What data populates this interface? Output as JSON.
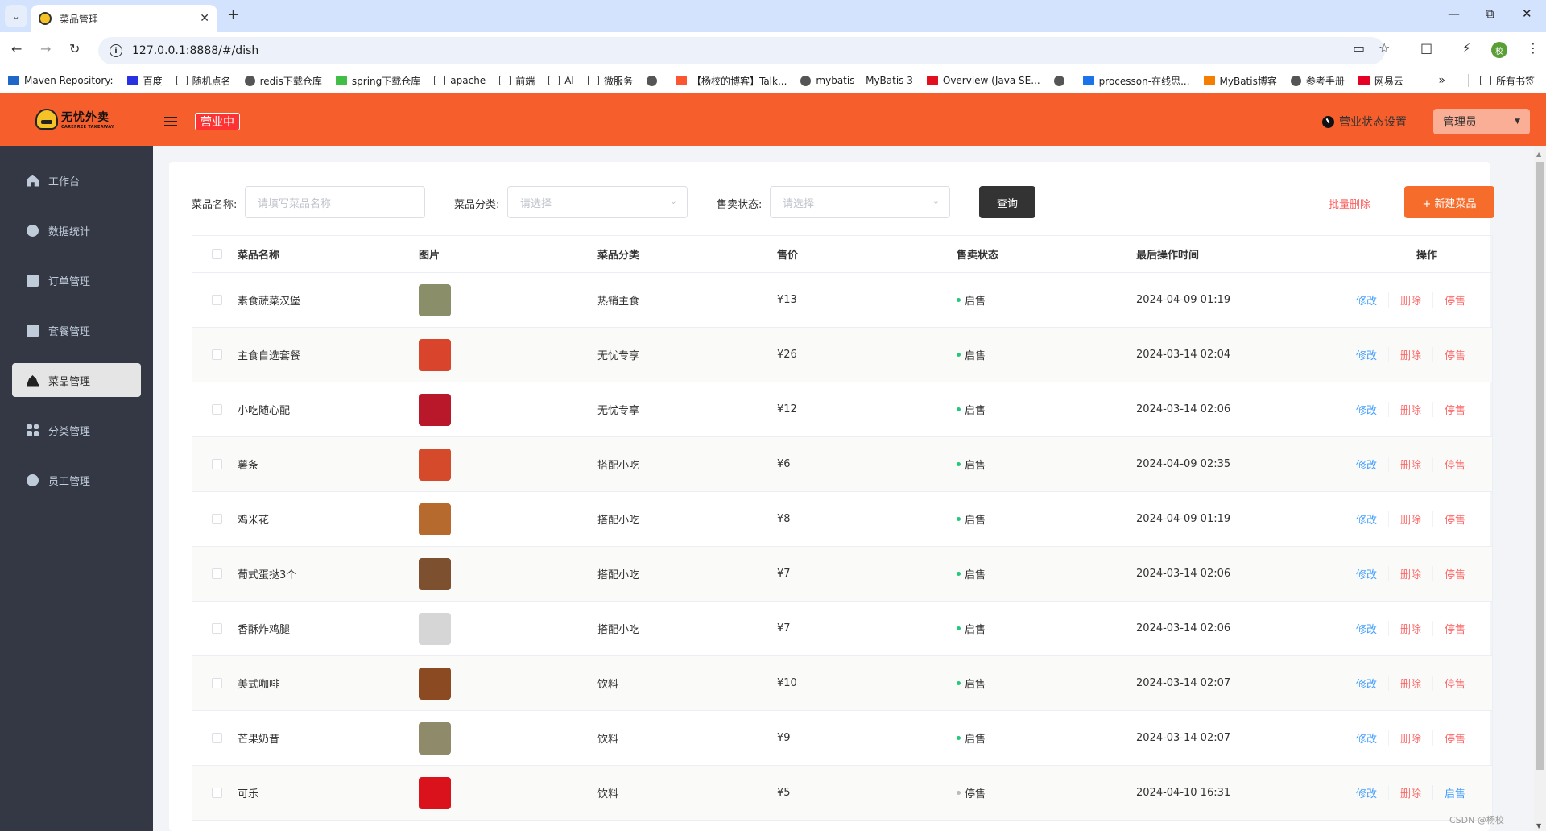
{
  "browser": {
    "tab_title": "菜品管理",
    "url": "127.0.0.1:8888/#/dish",
    "profile_initial": "校",
    "bookmarks": [
      {
        "label": "Maven Repository:",
        "icon": "mvn-icon",
        "color": "#1e66c8"
      },
      {
        "label": "百度",
        "icon": "baidu-icon",
        "color": "#2932e1"
      },
      {
        "label": "随机点名",
        "icon": "folder-icon",
        "color": ""
      },
      {
        "label": "redis下载仓库",
        "icon": "globe-icon",
        "color": ""
      },
      {
        "label": "spring下载仓库",
        "icon": "jfrog-icon",
        "color": "#40be46"
      },
      {
        "label": "apache",
        "icon": "folder-icon",
        "color": ""
      },
      {
        "label": "前端",
        "icon": "folder-icon",
        "color": ""
      },
      {
        "label": "AI",
        "icon": "folder-icon",
        "color": ""
      },
      {
        "label": "微服务",
        "icon": "folder-icon",
        "color": ""
      },
      {
        "label": "",
        "icon": "globe-icon",
        "color": ""
      },
      {
        "label": "【杨校的博客】Talk...",
        "icon": "csdn-icon",
        "color": "#fc5531"
      },
      {
        "label": "mybatis – MyBatis 3",
        "icon": "globe-icon",
        "color": ""
      },
      {
        "label": "Overview (Java SE...",
        "icon": "oracle-icon",
        "color": "#e0101e"
      },
      {
        "label": "",
        "icon": "globe-icon",
        "color": ""
      },
      {
        "label": "processon-在线思...",
        "icon": "processon-icon",
        "color": "#1a73e8"
      },
      {
        "label": "MyBatis博客",
        "icon": "blogger-icon",
        "color": "#f57d00"
      },
      {
        "label": "参考手册",
        "icon": "globe-icon",
        "color": ""
      },
      {
        "label": "网易云",
        "icon": "netease-icon",
        "color": "#e60026"
      }
    ],
    "more_bookmarks": "»",
    "all_bookmarks": "所有书签"
  },
  "header": {
    "logo_cn": "无忧外卖",
    "logo_en": "CAREFREE TAKEAWAY",
    "shop_status": "营业中",
    "biz_setting": "营业状态设置",
    "user": "管理员",
    "accent": "#f65e2c"
  },
  "sidebar": {
    "items": [
      {
        "label": "工作台",
        "icon": "home-icon"
      },
      {
        "label": "数据统计",
        "icon": "chart-icon"
      },
      {
        "label": "订单管理",
        "icon": "order-icon"
      },
      {
        "label": "套餐管理",
        "icon": "gift-icon"
      },
      {
        "label": "菜品管理",
        "icon": "dish-icon",
        "active": true
      },
      {
        "label": "分类管理",
        "icon": "grid-icon"
      },
      {
        "label": "员工管理",
        "icon": "staff-icon"
      }
    ]
  },
  "filters": {
    "name_label": "菜品名称:",
    "name_placeholder": "请填写菜品名称",
    "category_label": "菜品分类:",
    "category_placeholder": "请选择",
    "status_label": "售卖状态:",
    "status_placeholder": "请选择",
    "query_button": "查询",
    "batch_delete": "批量删除",
    "new_dish": "+ 新建菜品"
  },
  "table": {
    "columns": [
      "菜品名称",
      "图片",
      "菜品分类",
      "售价",
      "售卖状态",
      "最后操作时间",
      "操作"
    ],
    "rows": [
      {
        "name": "素食蔬菜汉堡",
        "category": "热销主食",
        "price": "¥13",
        "status": "启售",
        "on_sale": true,
        "time": "2024-04-09 01:19",
        "ops": [
          "修改",
          "删除",
          "停售"
        ],
        "img_color": "#8a8f6a"
      },
      {
        "name": "主食自选套餐",
        "category": "无忧专享",
        "price": "¥26",
        "status": "启售",
        "on_sale": true,
        "time": "2024-03-14 02:04",
        "ops": [
          "修改",
          "删除",
          "停售"
        ],
        "img_color": "#d9452c"
      },
      {
        "name": "小吃随心配",
        "category": "无忧专享",
        "price": "¥12",
        "status": "启售",
        "on_sale": true,
        "time": "2024-03-14 02:06",
        "ops": [
          "修改",
          "删除",
          "停售"
        ],
        "img_color": "#b8182a"
      },
      {
        "name": "薯条",
        "category": "搭配小吃",
        "price": "¥6",
        "status": "启售",
        "on_sale": true,
        "time": "2024-04-09 02:35",
        "ops": [
          "修改",
          "删除",
          "停售"
        ],
        "img_color": "#d44a2a"
      },
      {
        "name": "鸡米花",
        "category": "搭配小吃",
        "price": "¥8",
        "status": "启售",
        "on_sale": true,
        "time": "2024-04-09 01:19",
        "ops": [
          "修改",
          "删除",
          "停售"
        ],
        "img_color": "#b66a2e"
      },
      {
        "name": "葡式蛋挞3个",
        "category": "搭配小吃",
        "price": "¥7",
        "status": "启售",
        "on_sale": true,
        "time": "2024-03-14 02:06",
        "ops": [
          "修改",
          "删除",
          "停售"
        ],
        "img_color": "#7d5030"
      },
      {
        "name": "香酥炸鸡腿",
        "category": "搭配小吃",
        "price": "¥7",
        "status": "启售",
        "on_sale": true,
        "time": "2024-03-14 02:06",
        "ops": [
          "修改",
          "删除",
          "停售"
        ],
        "img_color": "#d6d6d6"
      },
      {
        "name": "美式咖啡",
        "category": "饮料",
        "price": "¥10",
        "status": "启售",
        "on_sale": true,
        "time": "2024-03-14 02:07",
        "ops": [
          "修改",
          "删除",
          "停售"
        ],
        "img_color": "#8b4a22"
      },
      {
        "name": "芒果奶昔",
        "category": "饮料",
        "price": "¥9",
        "status": "启售",
        "on_sale": true,
        "time": "2024-03-14 02:07",
        "ops": [
          "修改",
          "删除",
          "停售"
        ],
        "img_color": "#8e8a6a"
      },
      {
        "name": "可乐",
        "category": "饮料",
        "price": "¥5",
        "status": "停售",
        "on_sale": false,
        "time": "2024-04-10 16:31",
        "ops": [
          "修改",
          "删除",
          "启售"
        ],
        "img_color": "#d9121b"
      }
    ]
  },
  "watermark": "CSDN @杨校"
}
